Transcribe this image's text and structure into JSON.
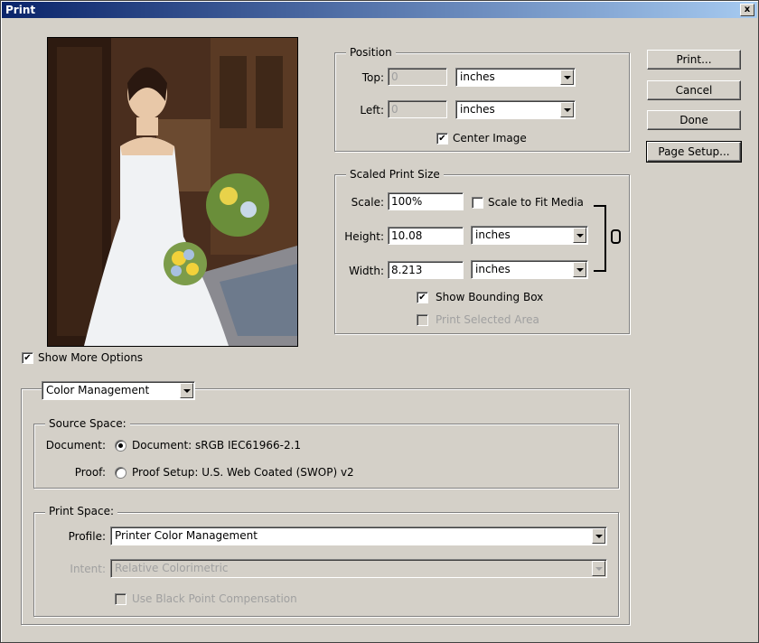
{
  "window": {
    "title": "Print",
    "close_glyph": "x"
  },
  "preview": {
    "description_icon": "photo-preview"
  },
  "position": {
    "legend": "Position",
    "top_label": "Top:",
    "top_value": "0",
    "top_unit": "inches",
    "left_label": "Left:",
    "left_value": "0",
    "left_unit": "inches",
    "center_image_label": "Center Image",
    "center_image_checked": true
  },
  "scaled": {
    "legend": "Scaled Print Size",
    "scale_label": "Scale:",
    "scale_value": "100%",
    "fit_label": "Scale to Fit Media",
    "fit_checked": false,
    "height_label": "Height:",
    "height_value": "10.08",
    "height_unit": "inches",
    "width_label": "Width:",
    "width_value": "8.213",
    "width_unit": "inches",
    "bounding_label": "Show Bounding Box",
    "bounding_checked": true,
    "selected_area_label": "Print Selected Area",
    "selected_area_checked": false
  },
  "buttons": {
    "print": "Print...",
    "cancel": "Cancel",
    "done": "Done",
    "page_setup": "Page Setup..."
  },
  "more_options": {
    "label": "Show More Options",
    "checked": true
  },
  "color_mgmt": {
    "mode": "Color Management",
    "source": {
      "legend": "Source Space:",
      "document_label": "Document:",
      "document_option": "Document:  sRGB IEC61966-2.1",
      "proof_label": "Proof:",
      "proof_option": "Proof Setup:  U.S. Web Coated (SWOP) v2",
      "selected": "document"
    },
    "print_space": {
      "legend": "Print Space:",
      "profile_label": "Profile:",
      "profile_value": "Printer Color Management",
      "intent_label": "Intent:",
      "intent_value": "Relative Colorimetric",
      "bpc_label": "Use Black Point Compensation",
      "bpc_checked": false
    }
  }
}
